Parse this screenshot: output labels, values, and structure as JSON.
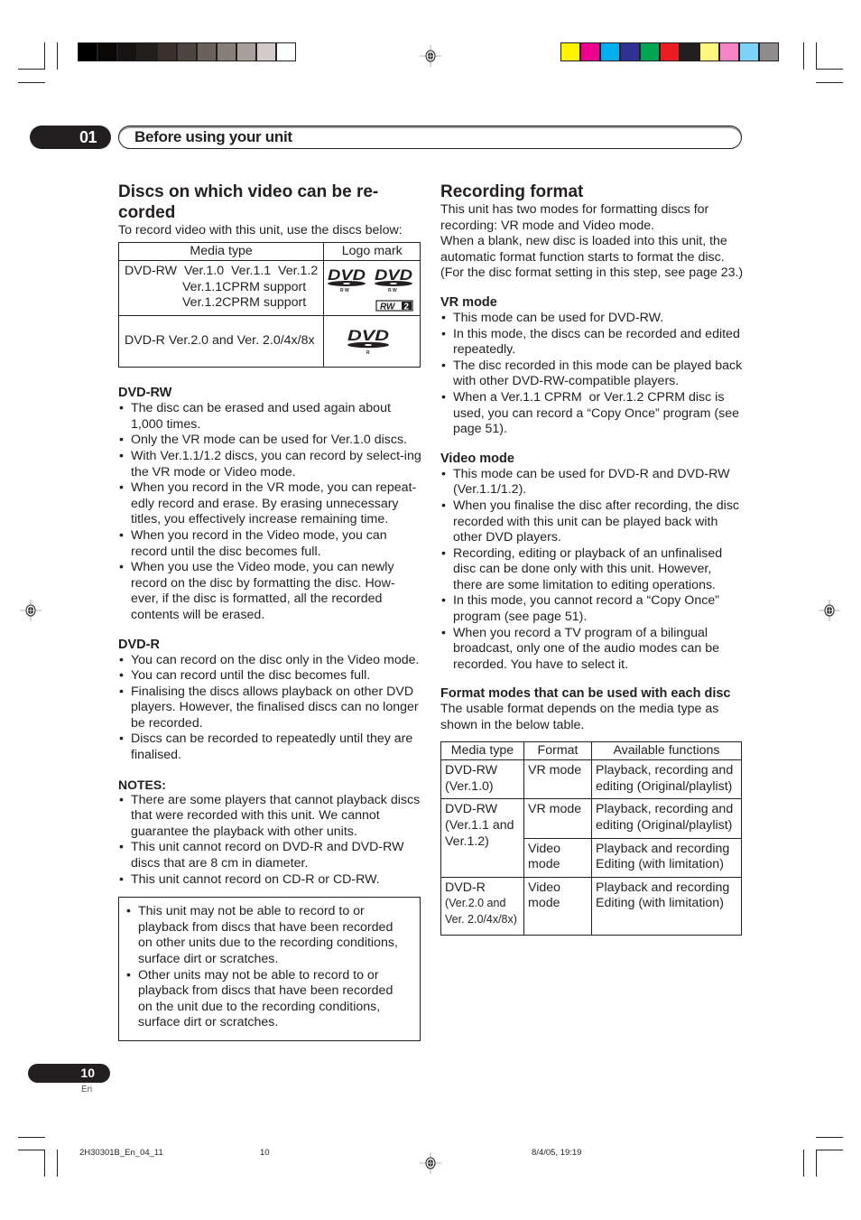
{
  "print_marks": {
    "gray_swatches": [
      "#000000",
      "#0b0908",
      "#171312",
      "#231f1d",
      "#3a302d",
      "#4e4542",
      "#6a605c",
      "#877d79",
      "#a9a09d",
      "#d2cbca",
      "#ffffff"
    ],
    "color_swatches": [
      "#fff200",
      "#ec008c",
      "#00aeef",
      "#2e3192",
      "#00a651",
      "#ed1c24",
      "#231f20",
      "#fff77e",
      "#f484c4",
      "#7dd3f6",
      "#8e8c8c"
    ]
  },
  "chapter": {
    "number": "01",
    "title": "Before using your unit"
  },
  "left": {
    "heading": "Discs on which video can be re-corded",
    "intro": "To record video with this unit, use the discs below:",
    "disc_table": {
      "headers": [
        "Media type",
        "Logo mark"
      ],
      "rows": [
        {
          "media_lines": [
            "DVD-RW  Ver.1.0  Ver.1.1  Ver.1.2",
            "Ver.1.1CPRM support",
            "Ver.1.2CPRM support"
          ],
          "logos": [
            "dvd-rw-logo",
            "dvd-rw-logo",
            "rw2-logo"
          ],
          "logo_sub": "RW",
          "rw2_label": "RW",
          "rw2_num": "2"
        },
        {
          "media_lines": [
            "DVD-R Ver.2.0 and Ver. 2.0/4x/8x"
          ],
          "logos": [
            "dvd-r-logo"
          ],
          "logo_sub": "R"
        }
      ]
    },
    "dvd_rw": {
      "heading": "DVD-RW",
      "bullets": [
        "The disc can be erased and used again about 1,000 times.",
        "Only the VR mode can be used for Ver.1.0 discs.",
        "With Ver.1.1/1.2 discs, you can record by select-ing the VR mode or Video mode.",
        "When you record in the VR mode, you can repeat-edly record and erase. By erasing unnecessary titles, you effectively increase remaining time.",
        "When you record in the Video mode, you can record until the disc becomes full.",
        "When you use the Video mode, you can newly record on the disc by formatting the disc. How-ever, if the disc is formatted, all the recorded contents will be erased."
      ]
    },
    "dvd_r": {
      "heading": "DVD-R",
      "bullets": [
        "You can record on the disc only in the Video mode.",
        "You can record until the disc becomes full.",
        "Finalising the discs allows playback on other DVD players. However, the finalised discs can no longer be recorded.",
        "Discs can be recorded to repeatedly until they are finalised."
      ]
    },
    "notes": {
      "heading": "NOTES:",
      "bullets": [
        "There are some players that cannot playback discs that were recorded with this unit. We cannot guarantee the playback with other units.",
        "This unit cannot record on DVD-R and DVD-RW discs that are 8 cm in diameter.",
        "This unit cannot record on CD-R or CD-RW."
      ]
    },
    "note_box": {
      "bullets": [
        "This unit may not be able to record to or playback from discs that have been recorded on other units due to the recording conditions, surface dirt or scratches.",
        "Other units may not be able to record to or playback from discs that have been recorded on the unit due to the recording conditions, surface dirt or scratches."
      ]
    }
  },
  "right": {
    "heading": "Recording format",
    "intro_1": "This unit has two modes for formatting discs for recording: VR mode and Video mode.",
    "intro_2": "When a blank, new disc is loaded into this unit, the automatic format function starts to format the disc. (For the disc format setting in this step, see page 23.)",
    "vr_mode": {
      "heading": "VR mode",
      "bullets": [
        "This mode can be used for DVD-RW.",
        "In this mode, the discs can be recorded and edited repeatedly.",
        "The disc recorded in this mode can be played back with other DVD-RW-compatible players.",
        "When a Ver.1.1 CPRM  or Ver.1.2 CPRM disc is used, you can record a “Copy Once” program (see page 51)."
      ]
    },
    "video_mode": {
      "heading": "Video mode",
      "bullets": [
        "This mode can be used for DVD-R and DVD-RW (Ver.1.1/1.2).",
        "When you finalise the disc after recording, the disc recorded with this unit can be played back with other DVD players.",
        "Recording, editing or playback of an unfinalised disc can be done only with this unit. However, there are some limitation to editing operations.",
        "In this mode, you cannot record a “Copy Once” program (see page 51).",
        "When you record a TV program of a bilingual broadcast, only one of the audio modes can be recorded. You have to select it."
      ]
    },
    "format_modes": {
      "heading": "Format modes that can be used with each disc",
      "intro": "The usable format depends on the media type as shown in the below table.",
      "table": {
        "headers": [
          "Media type",
          "Format",
          "Available functions"
        ],
        "rows": [
          {
            "media": "DVD-RW (Ver.1.0)",
            "format": "VR mode",
            "functions": "Playback, recording and editing (Original/playlist)"
          },
          {
            "media": "DVD-RW (Ver.1.1 and  Ver.1.2)",
            "format": "VR mode",
            "functions": "Playback, recording and editing (Original/playlist)"
          },
          {
            "media": "",
            "format": "Video mode",
            "functions": "Playback and recording Editing (with limitation)"
          },
          {
            "media": "DVD-R",
            "media_small": "(Ver.2.0 and Ver. 2.0/4x/8x)",
            "format": "Video mode",
            "functions": "Playback and recording Editing (with limitation)"
          }
        ]
      }
    }
  },
  "page": {
    "number": "10",
    "language": "En"
  },
  "footer": {
    "file": "2H30301B_En_04_11",
    "page": "10",
    "timestamp": "8/4/05, 19:19"
  }
}
